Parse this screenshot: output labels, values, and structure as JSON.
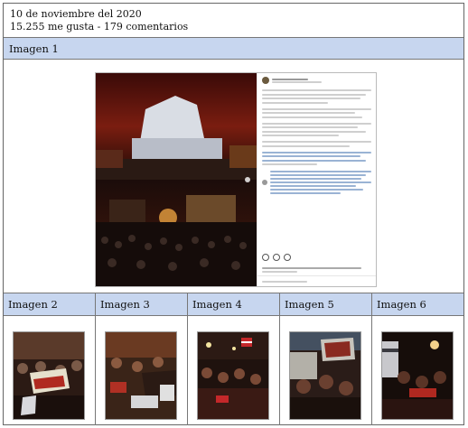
{
  "header": {
    "date": "10 de noviembre del 2020",
    "stats": "15.255 me gusta - 179 comentarios"
  },
  "main": {
    "label": "Imagen 1"
  },
  "thumbnails": [
    {
      "label": "Imagen 2"
    },
    {
      "label": "Imagen 3"
    },
    {
      "label": "Imagen 4"
    },
    {
      "label": "Imagen 5"
    },
    {
      "label": "Imagen 6"
    }
  ],
  "colors": {
    "header_bar": "#c7d6ef",
    "border": "#777777"
  }
}
